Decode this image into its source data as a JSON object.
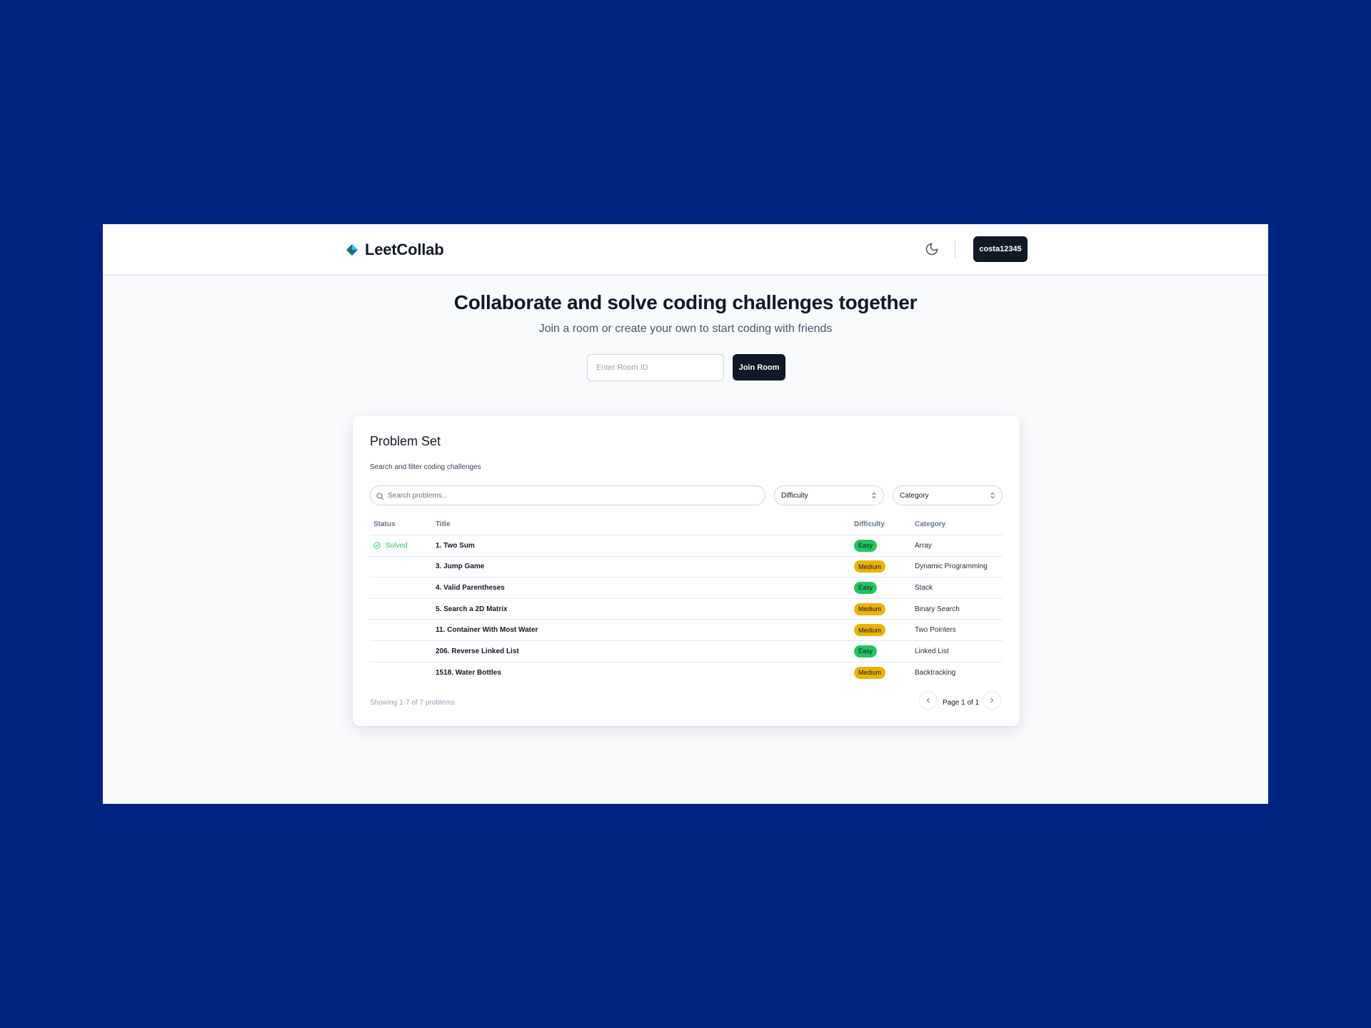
{
  "app": {
    "name": "LeetCollab"
  },
  "navbar": {
    "user": "costa12345"
  },
  "hero": {
    "title": "Collaborate and solve coding challenges together",
    "subtitle": "Join a room or create your own to start coding with friends",
    "room_input_placeholder": "Enter Room ID",
    "room_input_value": "",
    "join_label": "Join Room"
  },
  "problems": {
    "title": "Problem Set",
    "description": "Search and filter coding challenges",
    "search_placeholder": "Search problems...",
    "search_value": "",
    "difficulty_filter": "Difficulty",
    "category_filter": "Category",
    "columns": {
      "status": "Status",
      "title": "Title",
      "difficulty": "Difficulty",
      "category": "Category"
    },
    "rows": [
      {
        "status": "Solved",
        "title": "1. Two Sum",
        "difficulty": "Easy",
        "category": "Array"
      },
      {
        "status": "",
        "title": "3. Jump Game",
        "difficulty": "Medium",
        "category": "Dynamic Programming"
      },
      {
        "status": "",
        "title": "4. Valid Parentheses",
        "difficulty": "Easy",
        "category": "Stack"
      },
      {
        "status": "",
        "title": "5. Search a 2D Matrix",
        "difficulty": "Medium",
        "category": "Binary Search"
      },
      {
        "status": "",
        "title": "11. Container With Most Water",
        "difficulty": "Medium",
        "category": "Two Pointers"
      },
      {
        "status": "",
        "title": "206. Reverse Linked List",
        "difficulty": "Easy",
        "category": "Linked List"
      },
      {
        "status": "",
        "title": "1518. Water Bottles",
        "difficulty": "Medium",
        "category": "Backtracking"
      }
    ],
    "showing": "Showing 1-7 of 7 problems",
    "page_label": "Page 1 of 1"
  },
  "icons": {
    "brand": "diamond-icon",
    "theme": "moon-icon",
    "search": "search-icon",
    "select": "chevrons-up-down-icon",
    "solved": "check-circle-icon",
    "prev": "chevron-left-icon",
    "next": "chevron-right-icon"
  },
  "colors": {
    "backdrop": "#012482",
    "primary_button": "#111827",
    "easy": "#22c55e",
    "medium": "#eab308",
    "solved": "#22c55e"
  }
}
